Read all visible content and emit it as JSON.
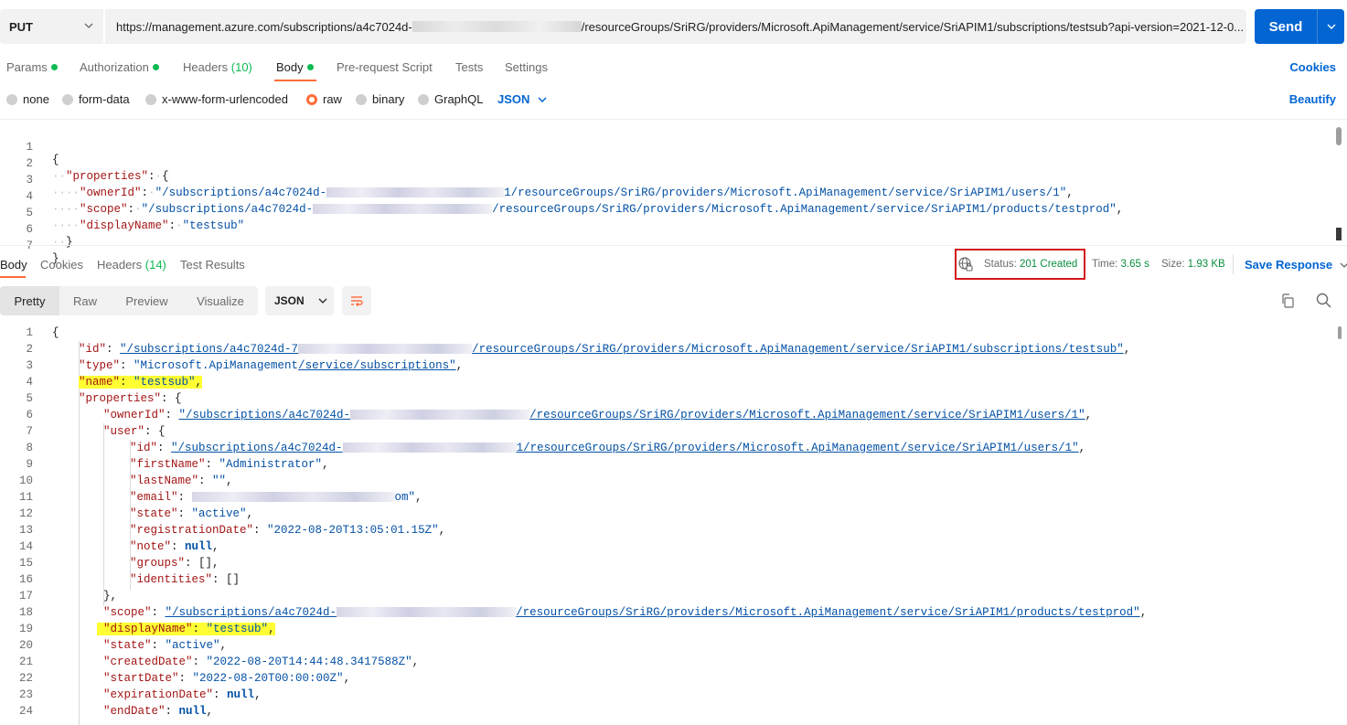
{
  "request": {
    "method": "PUT",
    "url_prefix": "https://management.azure.com/subscriptions/a4c7024d-",
    "url_suffix": "/resourceGroups/SriRG/providers/Microsoft.ApiManagement/service/SriAPIM1/subscriptions/testsub?api-version=2021-12-0...",
    "send_label": "Send"
  },
  "request_tabs": [
    {
      "label": "Params",
      "dot": true
    },
    {
      "label": "Authorization",
      "dot": true
    },
    {
      "label": "Headers",
      "count": "(10)"
    },
    {
      "label": "Body",
      "dot": true,
      "active": true
    },
    {
      "label": "Pre-request Script"
    },
    {
      "label": "Tests"
    },
    {
      "label": "Settings"
    }
  ],
  "cookies_label": "Cookies",
  "body_types": [
    {
      "label": "none"
    },
    {
      "label": "form-data"
    },
    {
      "label": "x-www-form-urlencoded"
    },
    {
      "label": "raw",
      "selected": true
    },
    {
      "label": "binary"
    },
    {
      "label": "GraphQL"
    }
  ],
  "raw_format": "JSON",
  "beautify_label": "Beautify",
  "request_body": {
    "line_numbers": [
      "1",
      "2",
      "3",
      "4",
      "5",
      "6",
      "7"
    ],
    "open_brace": "{",
    "properties_key": "\"properties\"",
    "ownerId_key": "\"ownerId\"",
    "ownerId_prefix": "\"/subscriptions/a4c7024d-",
    "ownerId_suffix": "1/resourceGroups/SriRG/providers/Microsoft.ApiManagement/service/SriAPIM1/users/1\"",
    "scope_key": "\"scope\"",
    "scope_prefix": "\"/subscriptions/a4c7024d-",
    "scope_suffix": "/resourceGroups/SriRG/providers/Microsoft.ApiManagement/service/SriAPIM1/products/testprod\"",
    "displayName_key": "\"displayName\"",
    "displayName_value": "\"testsub\"",
    "close_inner": "}",
    "close_brace": "}"
  },
  "response_tabs": [
    {
      "label": "Body",
      "active": true
    },
    {
      "label": "Cookies"
    },
    {
      "label": "Headers",
      "count": "(14)"
    },
    {
      "label": "Test Results"
    }
  ],
  "response_meta": {
    "status_label": "Status:",
    "status_value": "201 Created",
    "time_label": "Time:",
    "time_value": "3.65 s",
    "size_label": "Size:",
    "size_value": "1.93 KB",
    "save_response_label": "Save Response"
  },
  "view_modes": [
    "Pretty",
    "Raw",
    "Preview",
    "Visualize"
  ],
  "response_format": "JSON",
  "response_body": {
    "line_numbers": [
      "1",
      "2",
      "3",
      "4",
      "5",
      "6",
      "7",
      "8",
      "9",
      "10",
      "11",
      "12",
      "13",
      "14",
      "15",
      "16",
      "17",
      "18",
      "19",
      "20",
      "21",
      "22",
      "23",
      "24"
    ],
    "lines": {
      "l1": "{",
      "id_key": "\"id\"",
      "id_prefix": "\"/subscriptions/a4c7024d-7",
      "id_suffix": "/resourceGroups/SriRG/providers/Microsoft.ApiManagement/service/SriAPIM1/subscriptions/testsub\"",
      "type_key": "\"type\"",
      "type_value_a": "\"Microsoft.ApiManagement",
      "type_value_b": "/service/subscriptions\"",
      "name_key": "\"name\"",
      "name_value": "\"testsub\"",
      "properties_key": "\"properties\"",
      "ownerId_key": "\"ownerId\"",
      "ownerId_prefix": "\"/subscriptions/a4c7024d-",
      "ownerId_suffix": "/resourceGroups/SriRG/providers/Microsoft.ApiManagement/service/SriAPIM1/users/1\"",
      "user_key": "\"user\"",
      "user_id_key": "\"id\"",
      "user_id_prefix": "\"/subscriptions/a4c7024d-",
      "user_id_suffix": "1/resourceGroups/SriRG/providers/Microsoft.ApiManagement/service/SriAPIM1/users/1\"",
      "firstName_key": "\"firstName\"",
      "firstName_value": "\"Administrator\"",
      "lastName_key": "\"lastName\"",
      "lastName_value": "\"\"",
      "email_key": "\"email\"",
      "email_tail": "om\"",
      "state_key": "\"state\"",
      "state_value": "\"active\"",
      "registrationDate_key": "\"registrationDate\"",
      "registrationDate_value": "\"2022-08-20T13:05:01.15Z\"",
      "note_key": "\"note\"",
      "null_value": "null",
      "groups_key": "\"groups\"",
      "groups_value": "[]",
      "identities_key": "\"identities\"",
      "identities_value": "[]",
      "scope_key": "\"scope\"",
      "scope_prefix": "\"/subscriptions/a4c7024d-",
      "scope_suffix": "/resourceGroups/SriRG/providers/Microsoft.ApiManagement/service/SriAPIM1/products/testprod\"",
      "displayName_key": "\"displayName\"",
      "displayName_value": "\"testsub\"",
      "sub_state_key": "\"state\"",
      "sub_state_value": "\"active\"",
      "createdDate_key": "\"createdDate\"",
      "createdDate_value": "\"2022-08-20T14:44:48.3417588Z\"",
      "startDate_key": "\"startDate\"",
      "startDate_value": "\"2022-08-20T00:00:00Z\"",
      "expirationDate_key": "\"expirationDate\"",
      "endDate_key": "\"endDate\""
    }
  },
  "colors": {
    "accent": "#ff6c37",
    "primary_blue": "#0265d2",
    "success_green": "#0cbb52",
    "highlight": "#ffff33",
    "annotation_red": "#d4161d"
  }
}
